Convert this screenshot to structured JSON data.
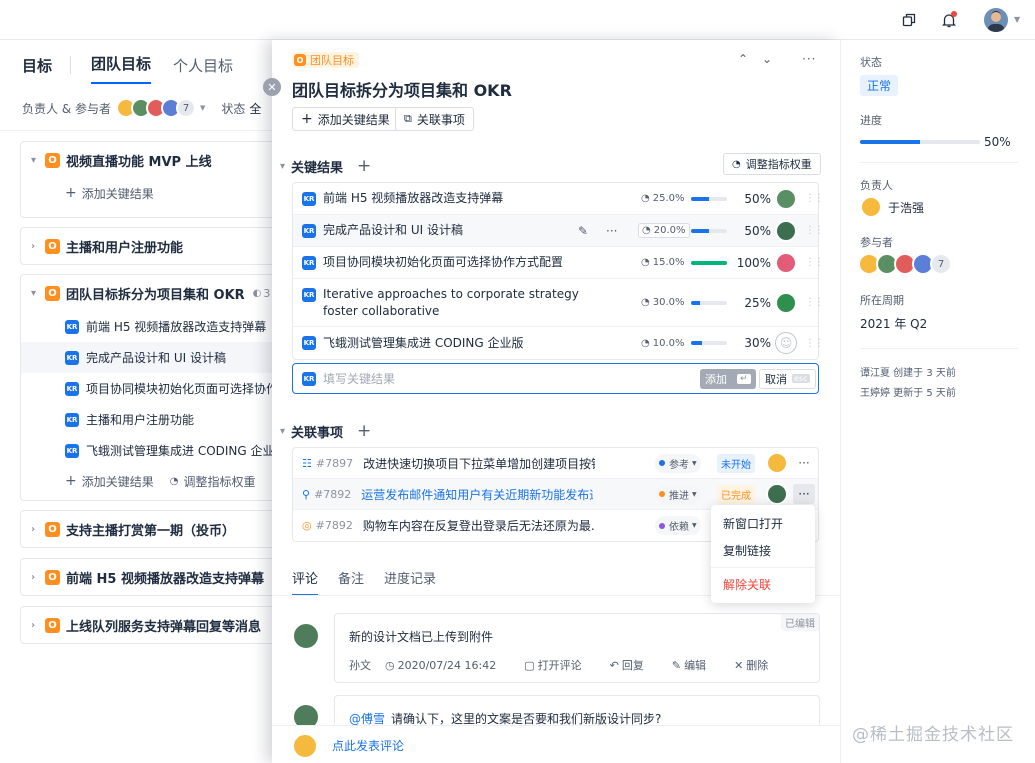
{
  "topbar": {
    "icons": [
      "window-icon",
      "bell-icon"
    ]
  },
  "left": {
    "tabs": [
      "目标",
      "团队目标",
      "个人目标"
    ],
    "filter_owner": "负责人 & 参与者",
    "filter_count": "7",
    "filter_status": "状态",
    "filter_status_val": "全",
    "cards": [
      {
        "title": "视频直播功能 MVP 上线",
        "add": "添加关键结果"
      },
      {
        "title": "主播和用户注册功能"
      },
      {
        "title": "团队目标拆分为项目集和 OKR",
        "comments": "3",
        "items": [
          "前端 H5 视频播放器改造支持弹幕",
          "完成产品设计和 UI 设计稿",
          "项目协同模块初始化页面可选择协作方式配置",
          "主播和用户注册功能",
          "飞蛾测试管理集成进 CODING 企业版"
        ],
        "add": "添加关键结果",
        "adjust": "调整指标权重"
      },
      {
        "title": "支持主播打赏第一期（投币）"
      },
      {
        "title": "前端 H5 视频播放器改造支持弹幕"
      },
      {
        "title": "上线队列服务支持弹幕回复等消息"
      }
    ]
  },
  "center": {
    "tag": "团队目标",
    "title": "团队目标拆分为项目集和 OKR",
    "btn_add_kr": "添加关键结果",
    "btn_link": "关联事项",
    "sec_kr": "关键结果",
    "btn_adjust": "调整指标权重",
    "krs": [
      {
        "text": "前端 H5 视频播放器改造支持弹幕",
        "weight": "25.0%",
        "progress": 50,
        "pct": "50%"
      },
      {
        "text": "完成产品设计和 UI 设计稿",
        "weight": "20.0%",
        "progress": 50,
        "pct": "50%"
      },
      {
        "text": "项目协同模块初始化页面可选择协作方式配置",
        "weight": "15.0%",
        "progress": 100,
        "pct": "100%"
      },
      {
        "text": "Iterative approaches to corporate strategy foster collaborative",
        "weight": "30.0%",
        "progress": 25,
        "pct": "25%"
      },
      {
        "text": "飞蛾测试管理集成进 CODING 企业版",
        "weight": "10.0%",
        "progress": 30,
        "pct": "30%"
      }
    ],
    "kr_input_placeholder": "填写关键结果",
    "kr_input_add": "添加",
    "kr_input_cancel": "取消",
    "kr_input_esc": "esc",
    "sec_rel": "关联事项",
    "rels": [
      {
        "id": "#7897",
        "title": "改进快速切换项目下拉菜单增加创建项目按钮",
        "type": "参考",
        "type_color": "#1a73e8",
        "status": "未开始",
        "status_color": "#1a73e8",
        "status_bg": "#e8f1fe"
      },
      {
        "id": "#7892",
        "title": "运营发布邮件通知用户有关近期新功能发布通知",
        "type": "推进",
        "type_color": "#ff8f1f",
        "status": "已完成",
        "status_color": "#ff8f1f",
        "status_bg": "#fff3e2"
      },
      {
        "id": "#7892",
        "title": "购物车内容在反复登出登录后无法还原为最...",
        "type": "依赖",
        "type_color": "#8e55e6",
        "status": "",
        "status_color": "#1a73e8",
        "status_bg": "#fff"
      }
    ],
    "menu": [
      "新窗口打开",
      "复制链接",
      "解除关联"
    ],
    "tabs": [
      "评论",
      "备注",
      "进度记录"
    ],
    "comment1": {
      "edited": "已编辑",
      "text": "新的设计文档已上传到附件",
      "author": "孙文",
      "time": "2020/07/24 16:42",
      "actions": [
        "打开评论",
        "回复",
        "编辑",
        "删除"
      ]
    },
    "comment2": {
      "mention": "@傅雪",
      "text": "请确认下，这里的文案是否要和我们新版设计同步?"
    },
    "post_comment": "点此发表评论"
  },
  "right": {
    "status_label": "状态",
    "status": "正常",
    "progress_label": "进度",
    "progress": 50,
    "progress_text": "50%",
    "owner_label": "负责人",
    "owner": "于浩强",
    "members_label": "参与者",
    "members_more": "7",
    "period_label": "所在周期",
    "period": "2021 年 Q2",
    "log1": "谭江夏 创建于 3 天前",
    "log2": "王婷婷 更新于 5 天前"
  },
  "watermark": "@稀土掘金技术社区",
  "colors": {
    "accent": "#1a73e8",
    "objective": "#ff8f1f",
    "danger": "#f0443b",
    "success": "#00b578"
  }
}
